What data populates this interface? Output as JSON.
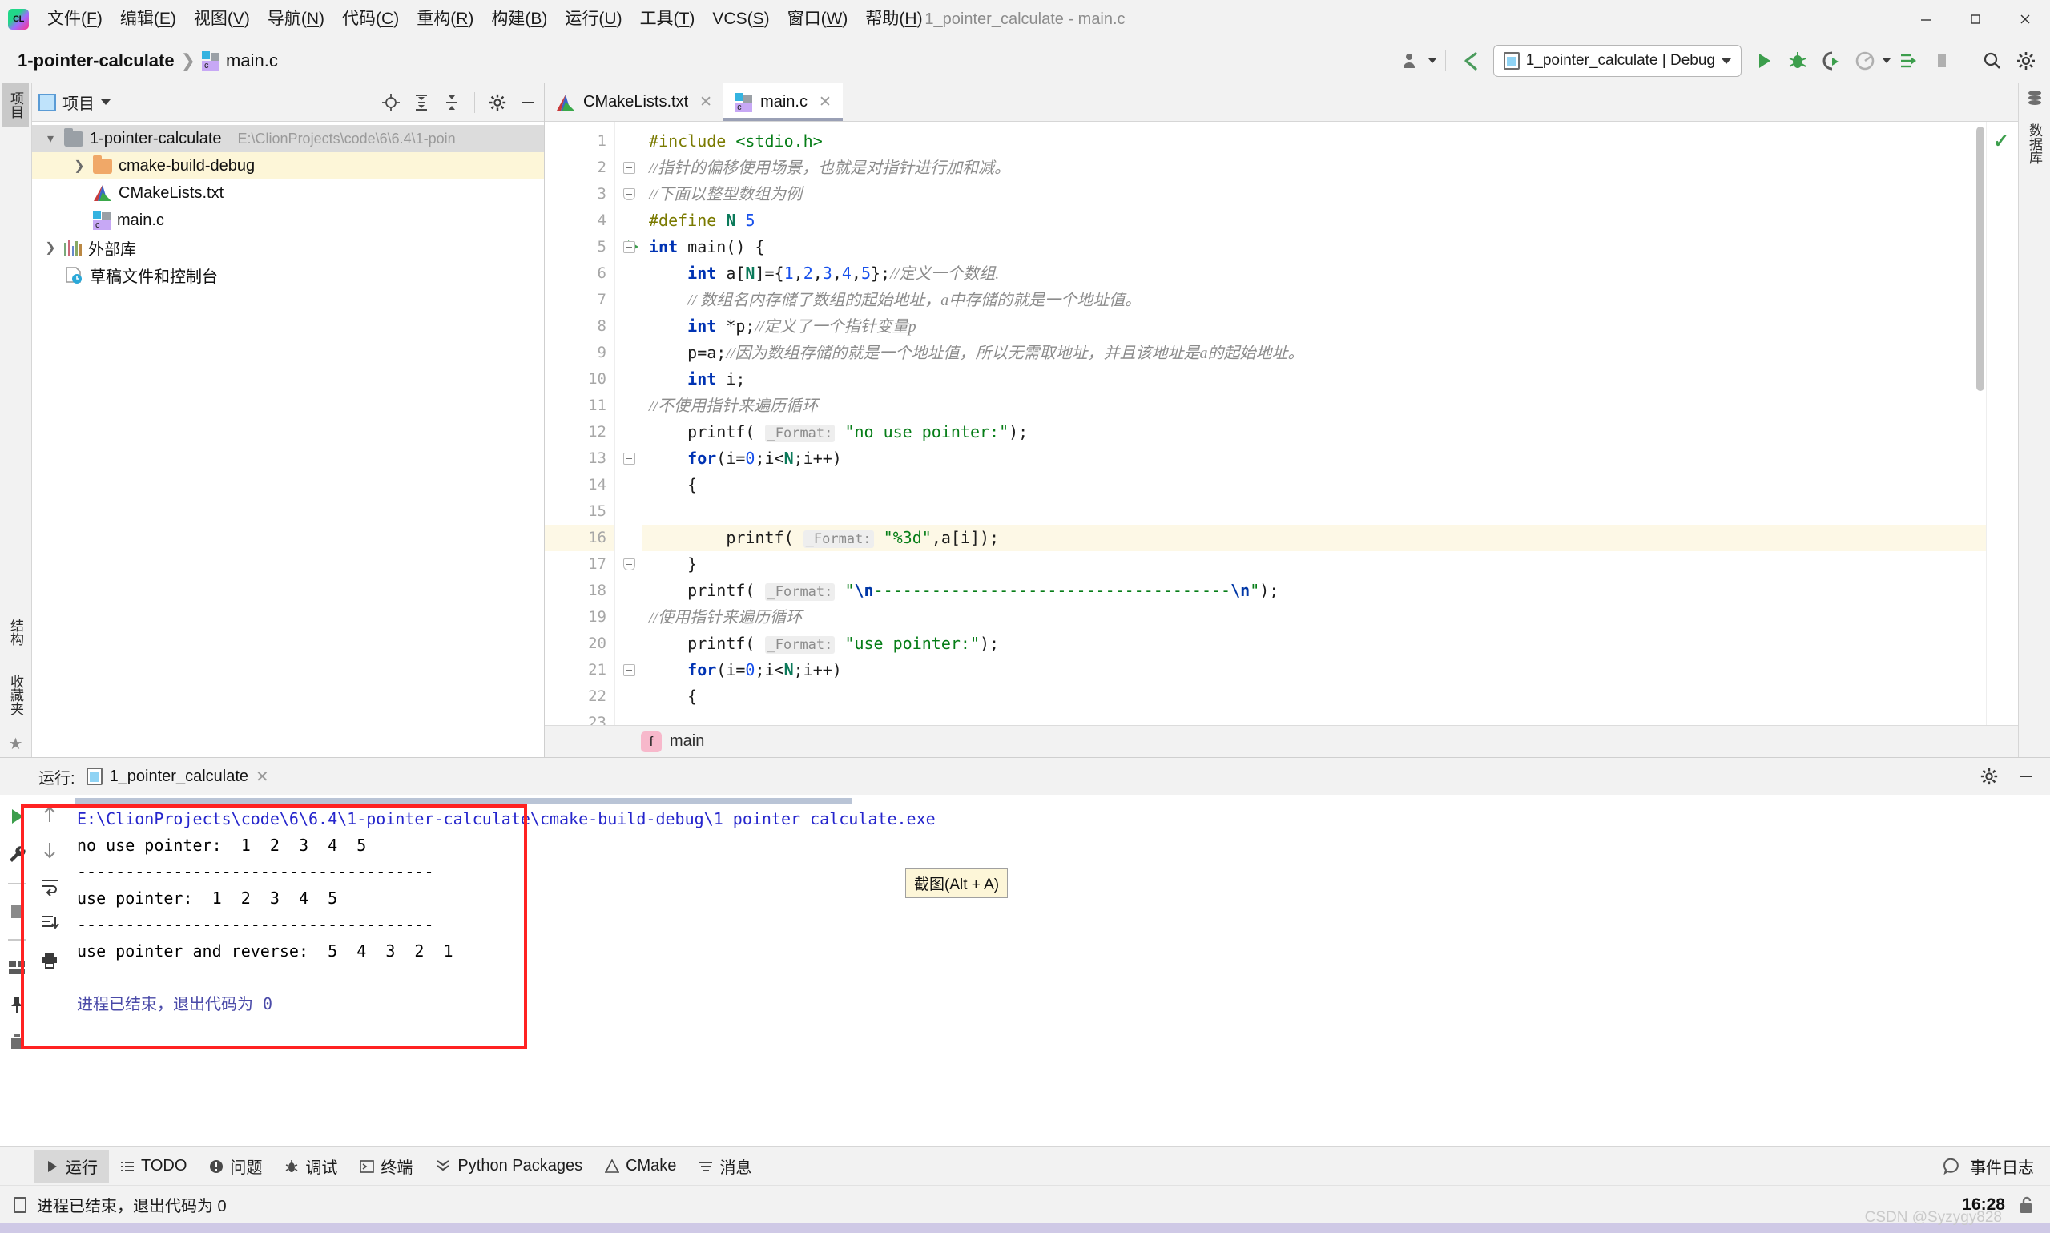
{
  "window": {
    "title": "1_pointer_calculate - main.c",
    "controls": [
      "minimize",
      "maximize",
      "close"
    ]
  },
  "menu": {
    "items": [
      {
        "label": "文件(F)",
        "mnemonic": "F"
      },
      {
        "label": "编辑(E)",
        "mnemonic": "E"
      },
      {
        "label": "视图(V)",
        "mnemonic": "V"
      },
      {
        "label": "导航(N)",
        "mnemonic": "N"
      },
      {
        "label": "代码(C)",
        "mnemonic": "C"
      },
      {
        "label": "重构(R)",
        "mnemonic": "R"
      },
      {
        "label": "构建(B)",
        "mnemonic": "B"
      },
      {
        "label": "运行(U)",
        "mnemonic": "U"
      },
      {
        "label": "工具(T)",
        "mnemonic": "T"
      },
      {
        "label": "VCS(S)",
        "mnemonic": "S"
      },
      {
        "label": "窗口(W)",
        "mnemonic": "W"
      },
      {
        "label": "帮助(H)",
        "mnemonic": "H"
      }
    ]
  },
  "navbar": {
    "project": "1-pointer-calculate",
    "separator": "❯",
    "file": "main.c",
    "run_config": "1_pointer_calculate | Debug",
    "actions": [
      "user-icon",
      "back-arrow-icon",
      "run-icon",
      "debug-icon",
      "run-with-coverage-icon",
      "profile-icon",
      "attach-icon",
      "stop-icon",
      "search-icon",
      "settings-icon"
    ]
  },
  "left_rail": {
    "tabs": [
      {
        "label": "项目",
        "active": true
      },
      {
        "label": "结构",
        "active": false
      },
      {
        "label": "收藏夹",
        "active": false
      }
    ]
  },
  "right_rail": {
    "tabs": [
      {
        "label": "数据库",
        "active": false
      }
    ]
  },
  "project_pane": {
    "title": "项目",
    "toolbar": [
      "locate-icon",
      "expand-all-icon",
      "collapse-all-icon",
      "gear-icon",
      "hide-icon"
    ],
    "tree": [
      {
        "indent": 0,
        "arrow": "▾",
        "icon": "folder",
        "label": "1-pointer-calculate",
        "path": "E:\\ClionProjects\\code\\6\\6.4\\1-poin",
        "state": "selected"
      },
      {
        "indent": 1,
        "arrow": "❯",
        "icon": "folder-orange",
        "label": "cmake-build-debug",
        "path": "",
        "state": "highlight"
      },
      {
        "indent": 1,
        "arrow": "",
        "icon": "cmake",
        "label": "CMakeLists.txt",
        "path": "",
        "state": ""
      },
      {
        "indent": 1,
        "arrow": "",
        "icon": "c-file",
        "label": "main.c",
        "path": "",
        "state": ""
      },
      {
        "indent": 0,
        "arrow": "❯",
        "icon": "library",
        "label": "外部库",
        "path": "",
        "state": ""
      },
      {
        "indent": 0,
        "arrow": "",
        "icon": "scratch",
        "label": "草稿文件和控制台",
        "path": "",
        "state": ""
      }
    ]
  },
  "editor": {
    "tabs": [
      {
        "label": "CMakeLists.txt",
        "icon": "cmake-icon",
        "active": false
      },
      {
        "label": "main.c",
        "icon": "c-file-icon",
        "active": true
      }
    ],
    "current_line": 16,
    "breadcrumb": {
      "badge": "f",
      "name": "main"
    },
    "inspection_status": "ok",
    "lines": [
      {
        "n": 1,
        "fold": "",
        "run": false,
        "html": "<span class=\"macro\">#include</span> <span class=\"str\">&lt;stdio.h&gt;</span>"
      },
      {
        "n": 2,
        "fold": "open",
        "run": false,
        "html": "<span class=\"cmt\">//指针的偏移使用场景，也就是对指针进行加和减。</span>"
      },
      {
        "n": 3,
        "fold": "close",
        "run": false,
        "html": "<span class=\"cmt\">//下面以整型数组为例</span>"
      },
      {
        "n": 4,
        "fold": "",
        "run": false,
        "html": "<span class=\"macro\">#define</span> <span class=\"macroname\">N</span> <span class=\"num\">5</span>"
      },
      {
        "n": 5,
        "fold": "open",
        "run": true,
        "html": "<span class=\"kw\">int</span> main() {"
      },
      {
        "n": 6,
        "fold": "",
        "run": false,
        "html": "    <span class=\"kw\">int</span> a[<span class=\"macroname\">N</span>]={<span class=\"num\">1</span>,<span class=\"num\">2</span>,<span class=\"num\">3</span>,<span class=\"num\">4</span>,<span class=\"num\">5</span>};<span class=\"cmt\">//定义一个数组.</span>"
      },
      {
        "n": 7,
        "fold": "",
        "run": false,
        "html": "    <span class=\"cmt\">// 数组名内存储了数组的起始地址，a中存储的就是一个地址值。</span>"
      },
      {
        "n": 8,
        "fold": "",
        "run": false,
        "html": "    <span class=\"kw\">int</span> *p;<span class=\"cmt\">//定义了一个指针变量p</span>"
      },
      {
        "n": 9,
        "fold": "",
        "run": false,
        "html": "    p=a;<span class=\"cmt\">//因为数组存储的就是一个地址值，所以无需取地址，并且该地址是a的起始地址。</span>"
      },
      {
        "n": 10,
        "fold": "",
        "run": false,
        "html": "    <span class=\"kw\">int</span> i;"
      },
      {
        "n": 11,
        "fold": "",
        "run": false,
        "html": "<span class=\"cmt\">//不使用指针来遍历循环</span>"
      },
      {
        "n": 12,
        "fold": "",
        "run": false,
        "html": "    printf( <span class=\"param\">_Format:</span> <span class=\"str\">\"no use pointer:\"</span>);"
      },
      {
        "n": 13,
        "fold": "open",
        "run": false,
        "html": "    <span class=\"kw\">for</span>(i=<span class=\"num\">0</span>;i&lt;<span class=\"macroname\">N</span>;i++)"
      },
      {
        "n": 14,
        "fold": "",
        "run": false,
        "html": "    {"
      },
      {
        "n": 15,
        "fold": "",
        "run": false,
        "html": ""
      },
      {
        "n": 16,
        "fold": "",
        "run": false,
        "html": "        printf( <span class=\"param\">_Format:</span> <span class=\"str\">\"%3d\"</span>,a[i]);"
      },
      {
        "n": 17,
        "fold": "close",
        "run": false,
        "html": "    }"
      },
      {
        "n": 18,
        "fold": "",
        "run": false,
        "html": "    printf( <span class=\"param\">_Format:</span> <span class=\"str\">\"</span><span class=\"esc\">\\n</span><span class=\"str\">-------------------------------------</span><span class=\"esc\">\\n</span><span class=\"str\">\"</span>);"
      },
      {
        "n": 19,
        "fold": "",
        "run": false,
        "html": "<span class=\"cmt\">//使用指针来遍历循环</span>"
      },
      {
        "n": 20,
        "fold": "",
        "run": false,
        "html": "    printf( <span class=\"param\">_Format:</span> <span class=\"str\">\"use pointer:\"</span>);"
      },
      {
        "n": 21,
        "fold": "open",
        "run": false,
        "html": "    <span class=\"kw\">for</span>(i=<span class=\"num\">0</span>;i&lt;<span class=\"macroname\">N</span>;i++)"
      },
      {
        "n": 22,
        "fold": "",
        "run": false,
        "html": "    {"
      },
      {
        "n": 23,
        "fold": "",
        "run": false,
        "html": ""
      }
    ]
  },
  "run_window": {
    "label": "运行:",
    "tab": "1_pointer_calculate",
    "close": "✕",
    "header_actions": [
      "gear-icon",
      "hide-icon"
    ],
    "left_toolbar": [
      "run-icon",
      "wrench-icon",
      "stop-icon",
      "layout-icon",
      "pin-icon",
      "trash-icon"
    ],
    "side_toolbar": [
      "up-arrow-icon",
      "down-arrow-icon",
      "soft-wrap-icon",
      "scroll-to-end-icon",
      "print-icon"
    ],
    "console": [
      {
        "text": "E:\\ClionProjects\\code\\6\\6.4\\1-pointer-calculate\\cmake-build-debug\\1_pointer_calculate.exe",
        "style": "path"
      },
      {
        "text": "no use pointer:  1  2  3  4  5",
        "style": "plain"
      },
      {
        "text": "-------------------------------------",
        "style": "plain"
      },
      {
        "text": "use pointer:  1  2  3  4  5",
        "style": "plain"
      },
      {
        "text": "-------------------------------------",
        "style": "plain"
      },
      {
        "text": "use pointer and reverse:  5  4  3  2  1",
        "style": "plain"
      },
      {
        "text": "",
        "style": "plain"
      },
      {
        "text": "进程已结束，退出代码为 0",
        "style": "end"
      }
    ]
  },
  "tooltip": {
    "text": "截图(Alt + A)"
  },
  "statusbar": {
    "items": [
      {
        "label": "运行",
        "icon": "run-icon",
        "active": true
      },
      {
        "label": "TODO",
        "icon": "list-icon",
        "active": false
      },
      {
        "label": "问题",
        "icon": "warning-icon",
        "active": false
      },
      {
        "label": "调试",
        "icon": "bug-icon",
        "active": false
      },
      {
        "label": "终端",
        "icon": "terminal-icon",
        "active": false
      },
      {
        "label": "Python Packages",
        "icon": "python-icon",
        "active": false
      },
      {
        "label": "CMake",
        "icon": "cmake-icon",
        "active": false
      },
      {
        "label": "消息",
        "icon": "message-icon",
        "active": false
      }
    ],
    "right": {
      "label": "事件日志",
      "icon": "event-log-icon"
    }
  },
  "infobar": {
    "message": "进程已结束，退出代码为 0",
    "icon": "console-icon",
    "time": "16:28",
    "lock_icon": "lock-open-icon",
    "watermark": "CSDN @Syzygy828"
  },
  "colors": {
    "accent_green": "#3c9e4c",
    "keyword_blue": "#0033b3",
    "string_green": "#067d17",
    "comment_gray": "#8c8c8c",
    "highlight_yellow": "#fdf8e6",
    "red_box": "#ff2222",
    "chrome_gray": "#f2f2f2"
  }
}
